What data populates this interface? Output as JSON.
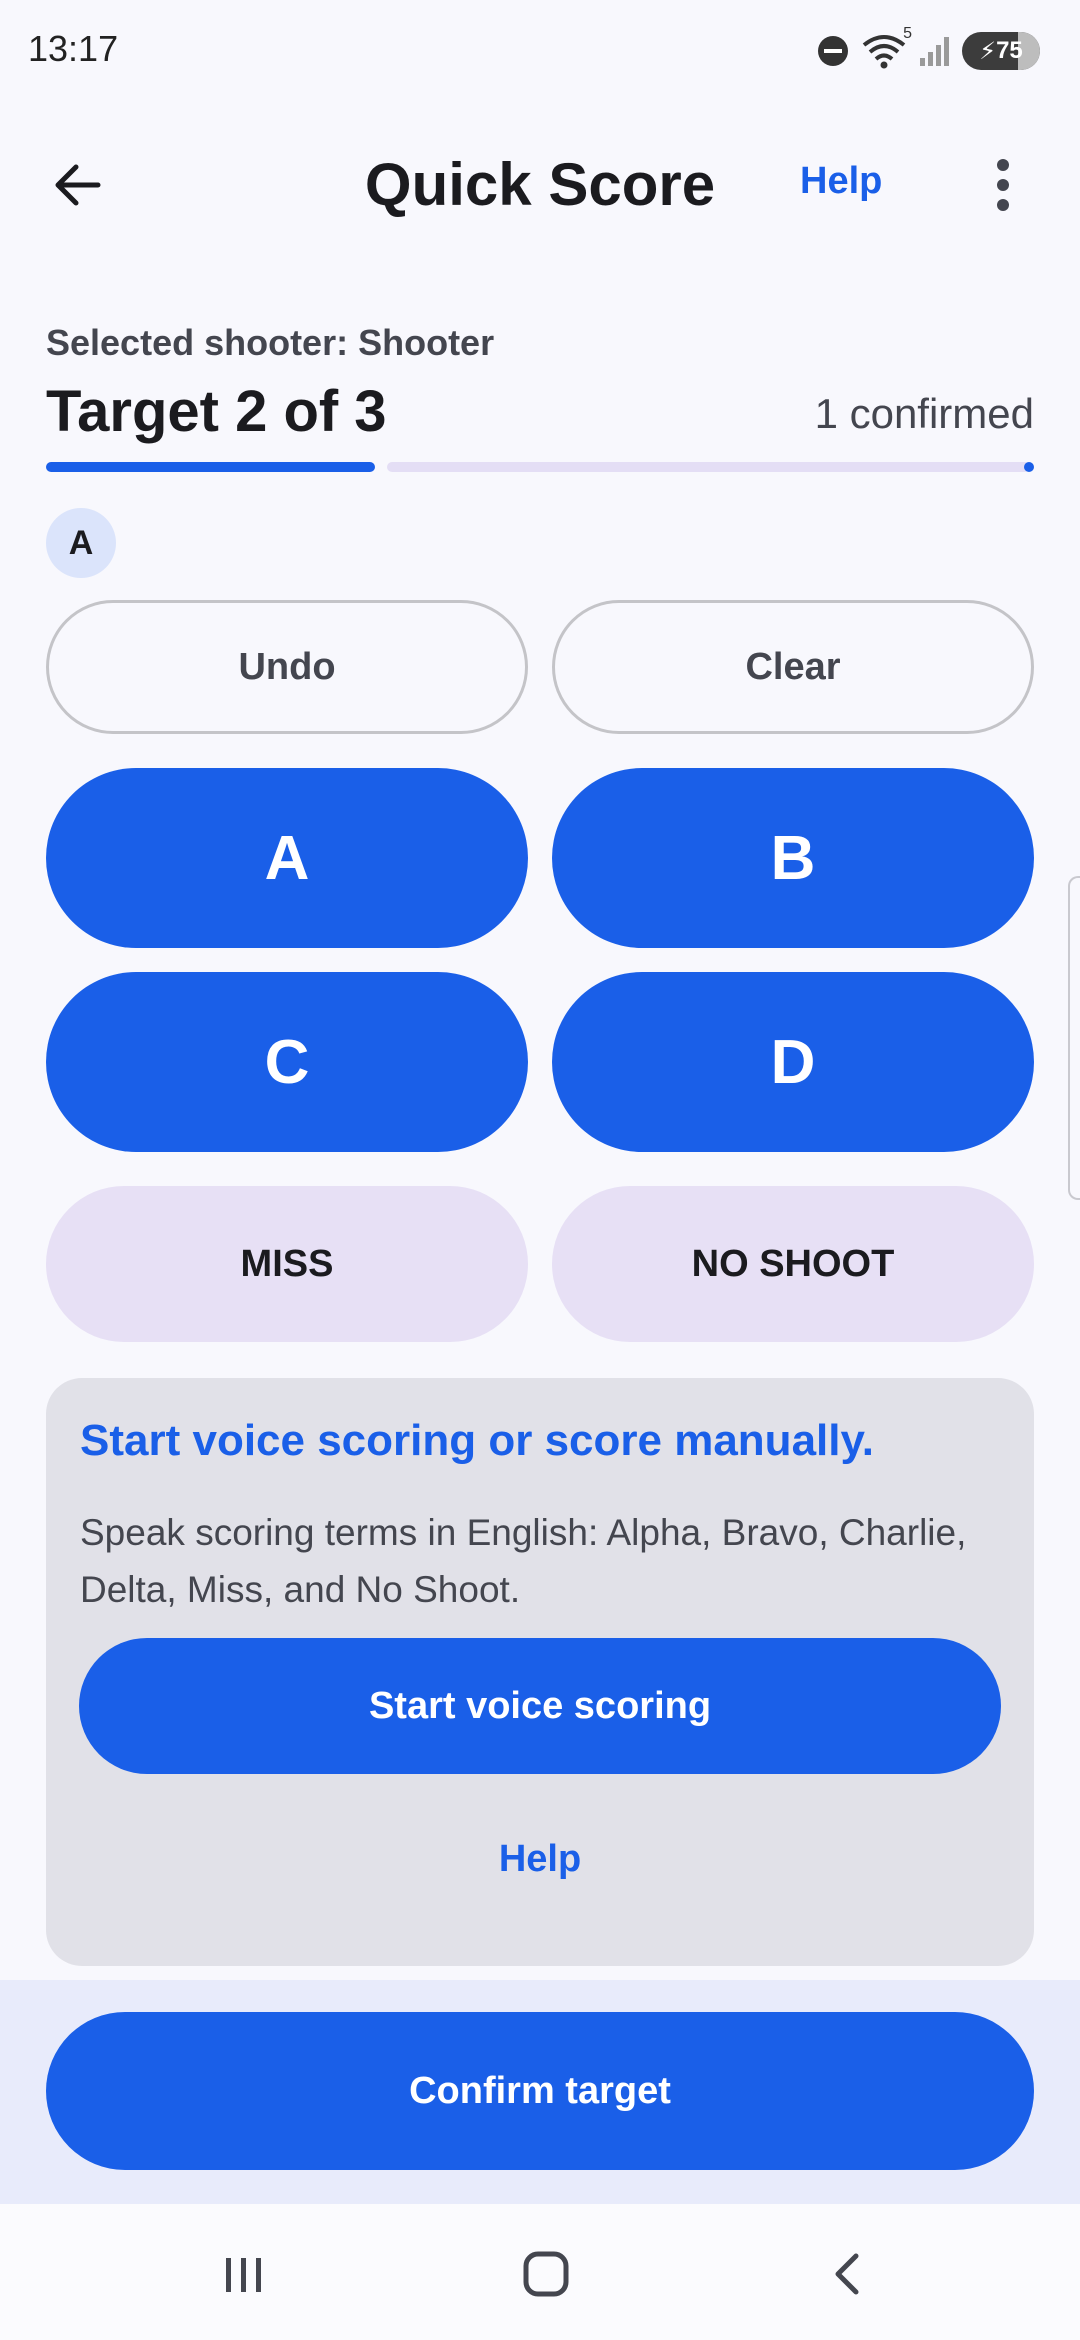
{
  "status_bar": {
    "time": "13:17",
    "signal_badge": "5",
    "battery": "75"
  },
  "app_bar": {
    "title": "Quick Score",
    "help_label": "Help",
    "back_icon": "arrow-left-icon",
    "more_icon": "more-vert-icon"
  },
  "target": {
    "selected_shooter": "Selected shooter: Shooter",
    "title": "Target 2 of 3",
    "confirmed": "1 confirmed",
    "progress": 0.333,
    "hits": [
      "A"
    ]
  },
  "actions": {
    "undo": "Undo",
    "clear": "Clear"
  },
  "zones": {
    "a": "A",
    "b": "B",
    "c": "C",
    "d": "D",
    "miss": "MISS",
    "no_shoot": "NO SHOOT"
  },
  "voice": {
    "title": "Start voice scoring or score manually.",
    "description": "Speak scoring terms in English: Alpha, Bravo, Charlie, Delta, Miss, and No Shoot.",
    "start_label": "Start voice scoring",
    "help_label": "Help"
  },
  "footer": {
    "confirm_label": "Confirm target"
  },
  "colors": {
    "primary": "#1a5fe8",
    "background": "#f8f8fd",
    "tonal": "#e7e0f5",
    "card": "#e1e1e8"
  }
}
